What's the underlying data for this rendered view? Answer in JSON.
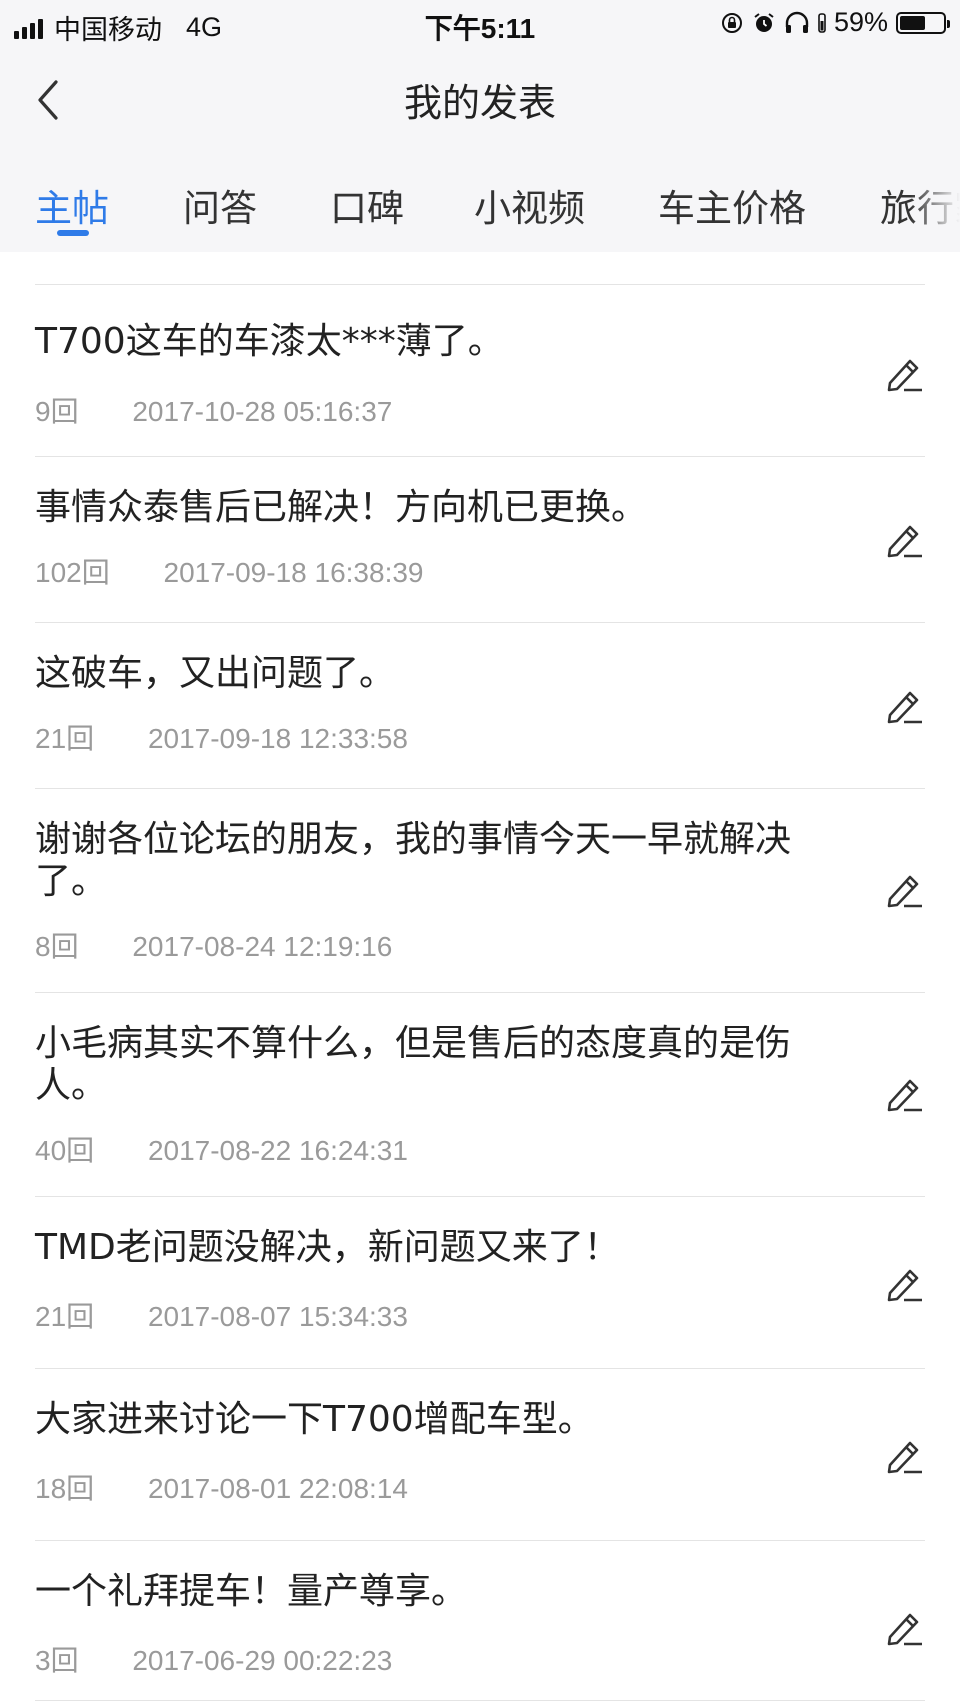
{
  "status_bar": {
    "carrier": "中国移动",
    "network": "4G",
    "time": "下午5:11",
    "battery_percent_label": "59%",
    "battery_level": 0.59
  },
  "nav": {
    "title": "我的发表",
    "back_icon": "chevron-left-icon"
  },
  "tabs": [
    {
      "label": "主帖",
      "active": true
    },
    {
      "label": "问答",
      "active": false
    },
    {
      "label": "口碑",
      "active": false
    },
    {
      "label": "小视频",
      "active": false
    },
    {
      "label": "车主价格",
      "active": false
    },
    {
      "label": "旅行家",
      "active": false
    }
  ],
  "accent_color": "#2f7be8",
  "posts": [
    {
      "title": "T700这车的车漆太***薄了。",
      "replies": "9回",
      "datetime": "2017-10-28 05:16:37"
    },
    {
      "title": "事情众泰售后已解决！方向机已更换。",
      "replies": "102回",
      "datetime": "2017-09-18 16:38:39"
    },
    {
      "title": "这破车，又出问题了。",
      "replies": "21回",
      "datetime": "2017-09-18 12:33:58"
    },
    {
      "title": "谢谢各位论坛的朋友，我的事情今天一早就解决了。",
      "replies": "8回",
      "datetime": "2017-08-24 12:19:16"
    },
    {
      "title": "小毛病其实不算什么，但是售后的态度真的是伤人。",
      "replies": "40回",
      "datetime": "2017-08-22 16:24:31"
    },
    {
      "title": "TMD老问题没解决，新问题又来了！",
      "replies": "21回",
      "datetime": "2017-08-07 15:34:33"
    },
    {
      "title": "大家进来讨论一下T700增配车型。",
      "replies": "18回",
      "datetime": "2017-08-01 22:08:14"
    },
    {
      "title": "一个礼拜提车！量产尊享。",
      "replies": "3回",
      "datetime": "2017-06-29 00:22:23"
    }
  ]
}
